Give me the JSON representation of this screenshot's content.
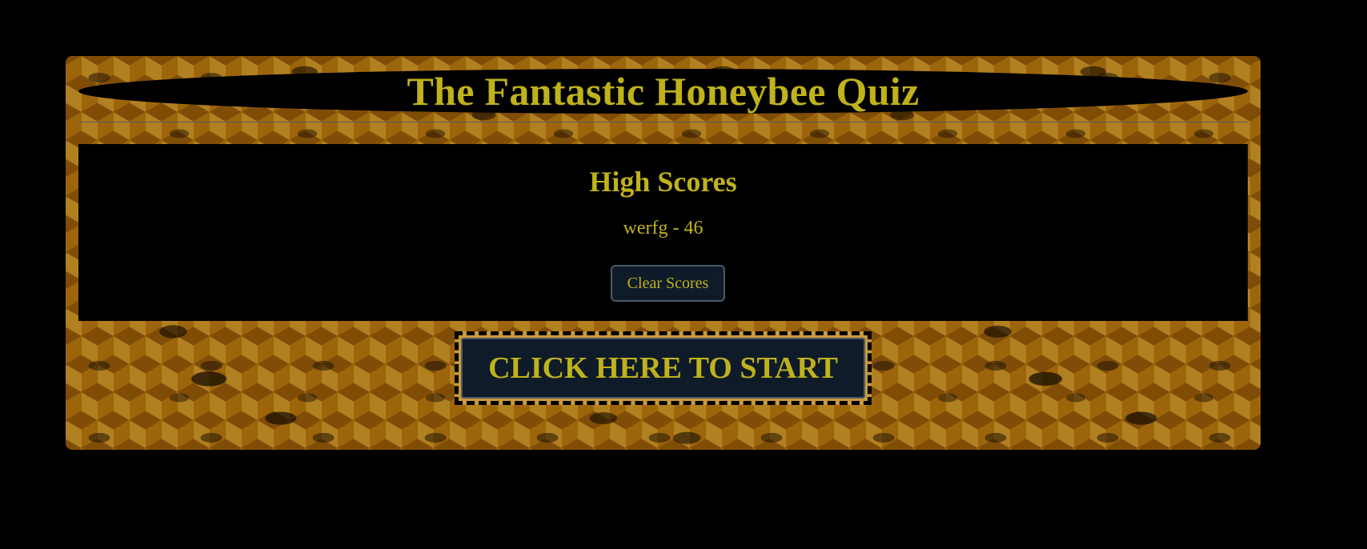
{
  "quiz": {
    "title": "The Fantastic Honeybee Quiz"
  },
  "high_scores": {
    "heading": "High Scores",
    "entries": [
      "werfg - 46"
    ],
    "clear_label": "Clear Scores"
  },
  "start": {
    "label": "CLICK HERE TO START"
  },
  "colors": {
    "text_accent": "#bfb21c",
    "button_bg": "#0f1b28",
    "panel_bg": "#000000",
    "page_bg": "#000000"
  },
  "background": {
    "image": "honeycomb-with-bees"
  }
}
